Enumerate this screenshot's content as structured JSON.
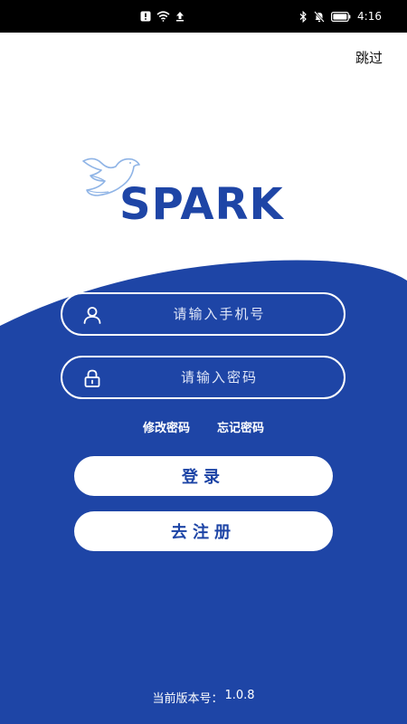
{
  "status_bar": {
    "time": "4:16",
    "icons": [
      "alert-icon",
      "wifi-icon",
      "upload-icon",
      "bluetooth-icon",
      "mute-icon",
      "battery-icon"
    ]
  },
  "header": {
    "skip_label": "跳过"
  },
  "logo": {
    "brand": "SPARK"
  },
  "form": {
    "phone_placeholder": "请输入手机号",
    "password_placeholder": "请输入密码",
    "phone_value": "",
    "password_value": ""
  },
  "links": {
    "change_password": "修改密码",
    "forgot_password": "忘记密码"
  },
  "buttons": {
    "login": "登录",
    "register": "去注册"
  },
  "footer": {
    "version_label": "当前版本号：",
    "version": "1.0.8"
  },
  "colors": {
    "primary": "#1e45a6",
    "light_blue": "#8fb4e6",
    "white": "#ffffff",
    "status_bar": "#000000"
  }
}
